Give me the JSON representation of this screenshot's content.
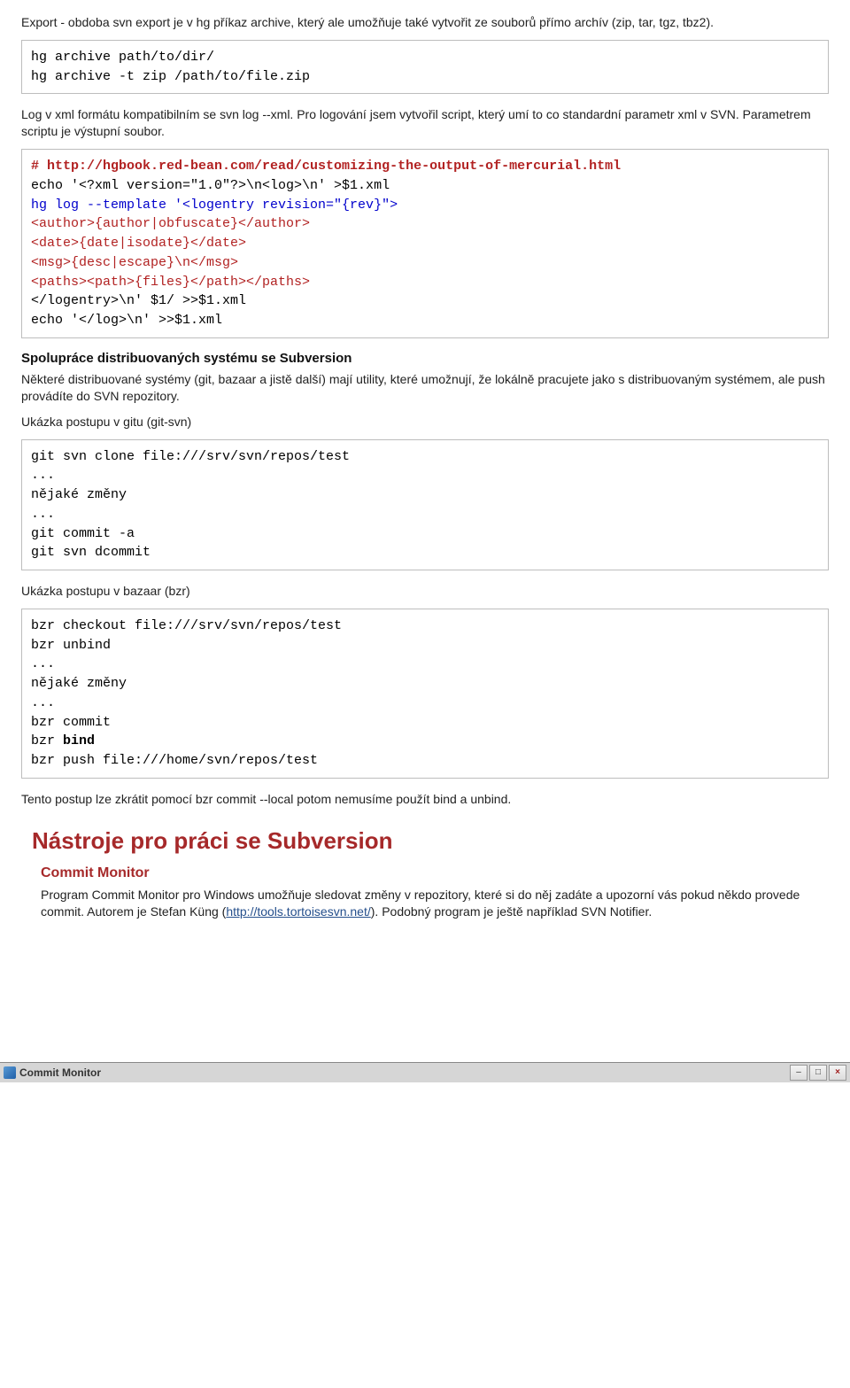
{
  "p_export_intro": "Export - obdoba svn export je v hg příkaz archive, který ale umožňuje také vytvořit ze souborů přímo archív (zip, tar, tgz, tbz2).",
  "code_archive": [
    {
      "cls": "l-black",
      "text": "hg archive path/to/dir/"
    },
    {
      "cls": "l-black",
      "text": "hg archive -t zip /path/to/file.zip"
    }
  ],
  "p_log_xml": "Log v xml formátu kompatibilním se svn log --xml. Pro logování jsem vytvořil script, který umí to co standardní parametr xml v SVN. Parametrem scriptu je výstupní soubor.",
  "code_log": [
    {
      "cls": "l-red-bold",
      "text": "# http://hgbook.red-bean.com/read/customizing-the-output-of-mercurial.html"
    },
    {
      "cls": "l-black",
      "text": "echo '<?xml version=\"1.0\"?>\\n<log>\\n' >$1.xml"
    },
    {
      "cls": "l-blue",
      "text": "hg log --template '<logentry revision=\"{rev}\">"
    },
    {
      "cls": "l-red",
      "text": "<author>{author|obfuscate}</author>"
    },
    {
      "cls": "l-red",
      "text": "<date>{date|isodate}</date>"
    },
    {
      "cls": "l-red",
      "text": "<msg>{desc|escape}\\n</msg>"
    },
    {
      "cls": "l-red",
      "text": "<paths><path>{files}</path></paths>"
    },
    {
      "cls": "l-black",
      "text": "</logentry>\\n' $1/ >>$1.xml"
    },
    {
      "cls": "l-black",
      "text": "echo '</log>\\n' >>$1.xml"
    }
  ],
  "h_spoluprace": "Spolupráce distribuovaných systému se Subversion",
  "p_spoluprace": "Některé distribuované systémy (git, bazaar a jistě další) mají utility, které umožnují, že lokálně pracujete jako s distribuovaným systémem, ale push provádíte do SVN repozitory.",
  "p_ukazka_git": "Ukázka postupu v gitu (git-svn)",
  "code_git": [
    {
      "cls": "l-black",
      "text": "git svn clone file:///srv/svn/repos/test"
    },
    {
      "cls": "l-black",
      "text": "..."
    },
    {
      "cls": "l-black",
      "text": "nějaké změny"
    },
    {
      "cls": "l-black",
      "text": "..."
    },
    {
      "cls": "l-black",
      "text": "git commit -a"
    },
    {
      "cls": "l-black",
      "text": "git svn dcommit"
    }
  ],
  "p_ukazka_bzr": "Ukázka postupu v bazaar (bzr)",
  "code_bzr": [
    {
      "cls": "l-black",
      "text": "bzr checkout file:///srv/svn/repos/test"
    },
    {
      "cls": "l-black",
      "text": "bzr unbind"
    },
    {
      "cls": "l-black",
      "text": "..."
    },
    {
      "cls": "l-black",
      "text": "nějaké změny"
    },
    {
      "cls": "l-black",
      "text": "..."
    },
    {
      "cls": "l-black",
      "text": "bzr commit"
    },
    {
      "cls": "l-black",
      "text": "bzr "
    },
    {
      "cls": "l-black",
      "text": "bzr push file:///home/svn/repos/test"
    }
  ],
  "bzr_bind_bold": "bind",
  "p_tento": "Tento postup lze zkrátit pomocí bzr commit --local potom nemusíme použít bind a unbind.",
  "h_nastroje": "Nástroje pro práci se Subversion",
  "h_commit_monitor": "Commit Monitor",
  "p_commit_monitor_1": "Program Commit Monitor pro Windows umožňuje sledovat změny v repozitory, které si do něj zadáte a upozorní vás pokud někdo provede commit. Autorem je Stefan Küng (",
  "link_tortoise": "http://tools.tortoisesvn.net/",
  "p_commit_monitor_2": "). Podobný program je ještě například SVN Notifier.",
  "footer_title": "Commit Monitor",
  "footer_btn_min": "–",
  "footer_btn_max": "□",
  "footer_btn_close": "×"
}
